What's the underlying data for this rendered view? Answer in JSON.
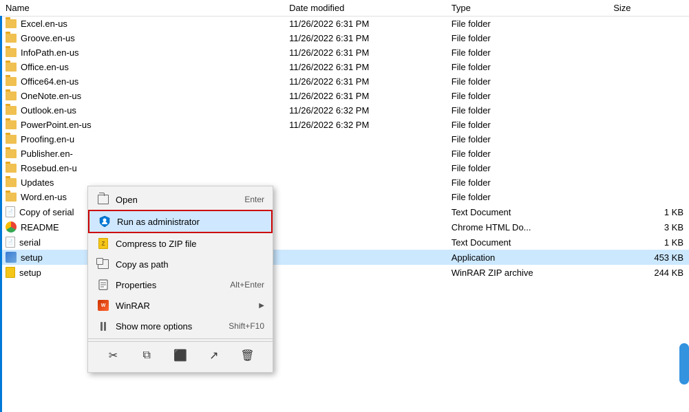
{
  "columns": {
    "name": "Name",
    "date_modified": "Date modified",
    "type": "Type",
    "size": "Size"
  },
  "files": [
    {
      "name": "Excel.en-us",
      "date": "11/26/2022 6:31 PM",
      "type": "File folder",
      "size": "",
      "icon": "folder"
    },
    {
      "name": "Groove.en-us",
      "date": "11/26/2022 6:31 PM",
      "type": "File folder",
      "size": "",
      "icon": "folder"
    },
    {
      "name": "InfoPath.en-us",
      "date": "11/26/2022 6:31 PM",
      "type": "File folder",
      "size": "",
      "icon": "folder"
    },
    {
      "name": "Office.en-us",
      "date": "11/26/2022 6:31 PM",
      "type": "File folder",
      "size": "",
      "icon": "folder"
    },
    {
      "name": "Office64.en-us",
      "date": "11/26/2022 6:31 PM",
      "type": "File folder",
      "size": "",
      "icon": "folder"
    },
    {
      "name": "OneNote.en-us",
      "date": "11/26/2022 6:31 PM",
      "type": "File folder",
      "size": "",
      "icon": "folder"
    },
    {
      "name": "Outlook.en-us",
      "date": "11/26/2022 6:32 PM",
      "type": "File folder",
      "size": "",
      "icon": "folder"
    },
    {
      "name": "PowerPoint.en-us",
      "date": "11/26/2022 6:32 PM",
      "type": "File folder",
      "size": "",
      "icon": "folder"
    },
    {
      "name": "Proofing.en-u",
      "date": "",
      "type": "File folder",
      "size": "",
      "icon": "folder"
    },
    {
      "name": "Publisher.en-",
      "date": "",
      "type": "File folder",
      "size": "",
      "icon": "folder"
    },
    {
      "name": "Rosebud.en-u",
      "date": "",
      "type": "File folder",
      "size": "",
      "icon": "folder"
    },
    {
      "name": "Updates",
      "date": "",
      "type": "File folder",
      "size": "",
      "icon": "folder"
    },
    {
      "name": "Word.en-us",
      "date": "",
      "type": "File folder",
      "size": "",
      "icon": "folder"
    },
    {
      "name": "Copy of serial",
      "date": "",
      "type": "Text Document",
      "size": "1 KB",
      "icon": "text"
    },
    {
      "name": "README",
      "date": "",
      "type": "Chrome HTML Do...",
      "size": "3 KB",
      "icon": "chrome"
    },
    {
      "name": "serial",
      "date": "",
      "type": "Text Document",
      "size": "1 KB",
      "icon": "text"
    },
    {
      "name": "setup",
      "date": "",
      "type": "Application",
      "size": "453 KB",
      "icon": "setup",
      "selected": true
    },
    {
      "name": "setup",
      "date": "",
      "type": "WinRAR ZIP archive",
      "size": "244 KB",
      "icon": "zip"
    }
  ],
  "context_menu": {
    "items": [
      {
        "id": "open",
        "label": "Open",
        "shortcut": "Enter",
        "icon": "open",
        "highlighted": false
      },
      {
        "id": "run_as_admin",
        "label": "Run as administrator",
        "shortcut": "",
        "icon": "shield",
        "highlighted": true
      },
      {
        "id": "compress_zip",
        "label": "Compress to ZIP file",
        "shortcut": "",
        "icon": "zip_compress",
        "highlighted": false
      },
      {
        "id": "copy_as_path",
        "label": "Copy as path",
        "shortcut": "",
        "icon": "copy_path",
        "highlighted": false
      },
      {
        "id": "properties",
        "label": "Properties",
        "shortcut": "Alt+Enter",
        "icon": "properties",
        "highlighted": false
      },
      {
        "id": "winrar",
        "label": "WinRAR",
        "shortcut": "",
        "icon": "winrar",
        "has_arrow": true,
        "highlighted": false
      },
      {
        "id": "show_more",
        "label": "Show more options",
        "shortcut": "Shift+F10",
        "icon": "more_options",
        "highlighted": false
      }
    ],
    "bottom_icons": [
      {
        "id": "cut",
        "icon": "scissors",
        "symbol": "✂"
      },
      {
        "id": "copy",
        "icon": "copy",
        "symbol": "⧉"
      },
      {
        "id": "paste_shortcut",
        "icon": "paste_shortcut",
        "symbol": "⬛"
      },
      {
        "id": "share",
        "icon": "share",
        "symbol": "↗"
      },
      {
        "id": "delete",
        "icon": "delete",
        "symbol": "🗑"
      }
    ]
  }
}
